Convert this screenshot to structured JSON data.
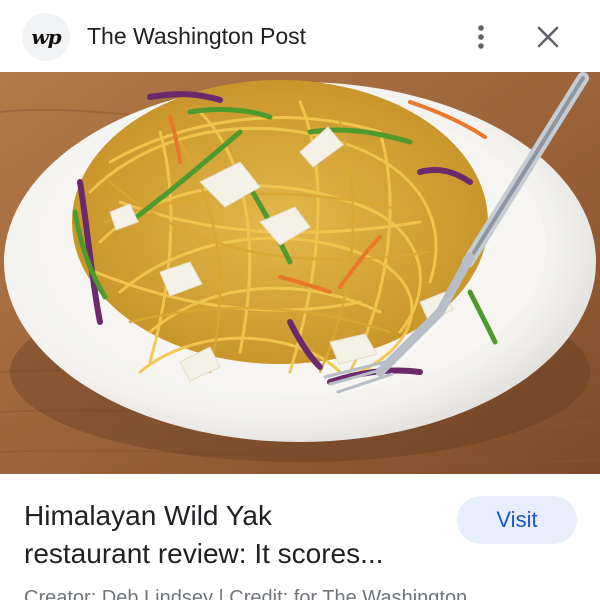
{
  "header": {
    "site_logo_text": "wp",
    "site_name": "The Washington Post",
    "more_icon": "more-vert-icon",
    "close_icon": "close-icon"
  },
  "image": {
    "subject": "noodle-dish-photo"
  },
  "article": {
    "title_line1": "Himalayan Wild Yak",
    "title_line2": "restaurant review: It scores...",
    "visit_label": "Visit",
    "credit": "Creator: Deb Lindsey | Credit: for The Washington"
  },
  "colors": {
    "visit_bg": "#e8eefc",
    "visit_text": "#1a56c8",
    "title_text": "#202124",
    "credit_text": "#70757a"
  }
}
